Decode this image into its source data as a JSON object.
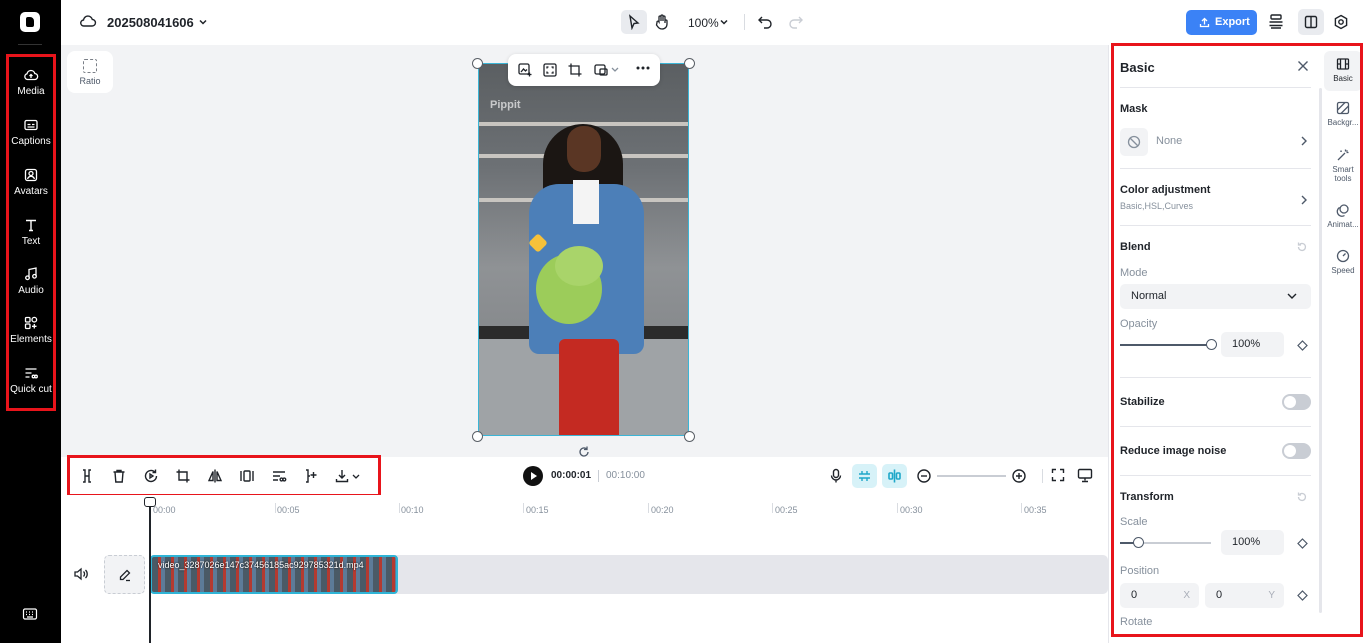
{
  "app": {
    "project_title": "202508041606",
    "zoom": "100%",
    "export_label": "Export"
  },
  "sidebar": {
    "items": [
      {
        "label": "Media",
        "icon": "cloud-upload-icon"
      },
      {
        "label": "Captions",
        "icon": "captions-icon"
      },
      {
        "label": "Avatars",
        "icon": "avatar-icon"
      },
      {
        "label": "Text",
        "icon": "text-icon"
      },
      {
        "label": "Audio",
        "icon": "music-note-icon"
      },
      {
        "label": "Elements",
        "icon": "elements-icon"
      },
      {
        "label": "Quick cut",
        "icon": "quick-cut-icon"
      }
    ]
  },
  "canvas": {
    "ratio_label": "Ratio",
    "watermark": "Pippit"
  },
  "playback": {
    "current_time": "00:00:01",
    "total_time": "00:10:00"
  },
  "timeline": {
    "ruler_labels": [
      "00:00",
      "00:05",
      "00:10",
      "00:15",
      "00:20",
      "00:25",
      "00:30",
      "00:35"
    ],
    "clip_name": "video_3287026e147c37456185ac929785321d.mp4"
  },
  "panel": {
    "title": "Basic",
    "mask": {
      "title": "Mask",
      "value": "None"
    },
    "color_adjustment": {
      "title": "Color adjustment",
      "subtitle": "Basic,HSL,Curves"
    },
    "blend": {
      "title": "Blend",
      "mode_label": "Mode",
      "mode_value": "Normal",
      "opacity_label": "Opacity",
      "opacity_value": "100%",
      "opacity_fraction": 1.0
    },
    "stabilize": {
      "title": "Stabilize",
      "enabled": false
    },
    "reduce_noise": {
      "title": "Reduce image noise",
      "enabled": false
    },
    "transform": {
      "title": "Transform",
      "scale_label": "Scale",
      "scale_value": "100%",
      "position_label": "Position",
      "pos_x": "0",
      "pos_y": "0",
      "x_axis": "X",
      "y_axis": "Y",
      "rotate_label": "Rotate"
    }
  },
  "tabs": [
    {
      "label": "Basic",
      "active": true
    },
    {
      "label": "Backgr...",
      "active": false
    },
    {
      "label": "Smart tools",
      "active": false
    },
    {
      "label": "Animat...",
      "active": false
    },
    {
      "label": "Speed",
      "active": false
    }
  ],
  "colors": {
    "accent": "#3b82f6",
    "highlight_box": "#e8141b",
    "selection": "#2fb4d6"
  }
}
